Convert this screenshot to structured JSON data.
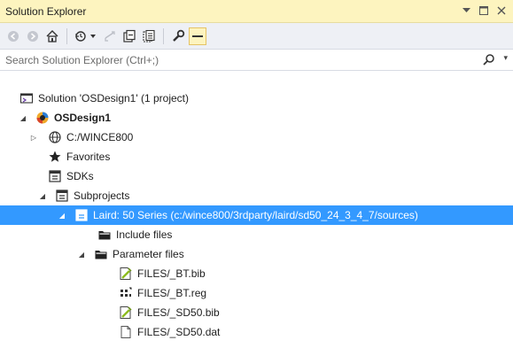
{
  "window": {
    "title": "Solution Explorer",
    "controls": [
      "chevron-down-icon",
      "maximize-icon",
      "close-icon"
    ]
  },
  "toolbar": {
    "buttons": [
      "back-icon",
      "forward-icon",
      "home-icon",
      "history-icon",
      "refresh-icon",
      "collapse-all-icon",
      "show-all-files-icon",
      "properties-icon",
      "pin-icon"
    ]
  },
  "search": {
    "placeholder": "Search Solution Explorer (Ctrl+;)"
  },
  "tree": [
    {
      "label": "Solution 'OSDesign1' (1 project)",
      "level": 0,
      "icon": "solution-icon",
      "expander": "none"
    },
    {
      "label": "OSDesign1",
      "level": 0,
      "icon": "project-icon",
      "expander": "expanded",
      "bold": true
    },
    {
      "label": "C:/WINCE800",
      "level": 1,
      "icon": "globe-icon",
      "expander": "collapsed"
    },
    {
      "label": "Favorites",
      "level": 1,
      "icon": "star-icon",
      "expander": "none"
    },
    {
      "label": "SDKs",
      "level": 1,
      "icon": "sdk-icon",
      "expander": "none"
    },
    {
      "label": "Subprojects",
      "level": 1,
      "icon": "subprojects-icon",
      "expander": "expanded"
    },
    {
      "label": "Laird: 50 Series (c:/wince800/3rdparty/laird/sd50_24_3_4_7/sources)",
      "level": 2,
      "icon": "subproject-icon",
      "expander": "expanded",
      "selected": true
    },
    {
      "label": "Include files",
      "level": 3,
      "icon": "folder-icon",
      "expander": "none"
    },
    {
      "label": "Parameter files",
      "level": 3,
      "icon": "folder-icon",
      "expander": "expanded"
    },
    {
      "label": "FILES/_BT.bib",
      "level": 4,
      "icon": "bib-file-icon",
      "expander": "none"
    },
    {
      "label": "FILES/_BT.reg",
      "level": 4,
      "icon": "reg-file-icon",
      "expander": "none"
    },
    {
      "label": "FILES/_SD50.bib",
      "level": 4,
      "icon": "bib-file-icon",
      "expander": "none"
    },
    {
      "label": "FILES/_SD50.dat",
      "level": 4,
      "icon": "file-icon",
      "expander": "none"
    }
  ],
  "colors": {
    "titlebar": "#fdf4bf",
    "toolbar": "#eef0f5",
    "selection": "#3399ff"
  }
}
